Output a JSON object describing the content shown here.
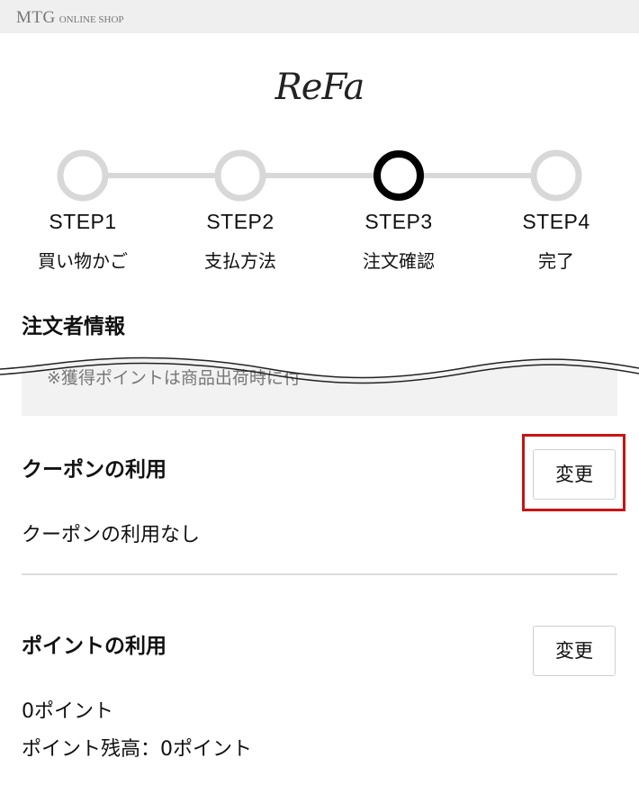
{
  "header": {
    "shop_name_main": "MTG",
    "shop_name_sub": "ONLINE SHOP",
    "brand_logo": "ReFa"
  },
  "steps": [
    {
      "label": "STEP1",
      "sub": "買い物かご",
      "active": false
    },
    {
      "label": "STEP2",
      "sub": "支払方法",
      "active": false
    },
    {
      "label": "STEP3",
      "sub": "注文確認",
      "active": true
    },
    {
      "label": "STEP4",
      "sub": "完了",
      "active": false
    }
  ],
  "orderer": {
    "title": "注文者情報",
    "note": "※獲得ポイントは商品出荷時に付"
  },
  "coupon": {
    "title": "クーポンの利用",
    "change_label": "変更",
    "value": "クーポンの利用なし"
  },
  "points": {
    "title": "ポイントの利用",
    "change_label": "変更",
    "value": "0ポイント",
    "balance": "ポイント残高：0ポイント"
  },
  "colors": {
    "step_inactive": "#d8d8d8",
    "step_active": "#000000",
    "highlight": "#c81414",
    "note_bg": "#f2f2f2"
  }
}
